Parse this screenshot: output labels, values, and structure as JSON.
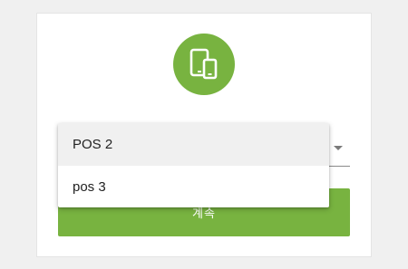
{
  "header": {
    "icon": "tablet-phone-devices-icon",
    "accent_color": "#78b340"
  },
  "pos_select": {
    "options": [
      {
        "label": "POS 2",
        "highlighted": true
      },
      {
        "label": "pos 3",
        "highlighted": false
      }
    ],
    "arrow_icon": "dropdown-arrow-icon"
  },
  "continue_button": {
    "label": "계속"
  }
}
